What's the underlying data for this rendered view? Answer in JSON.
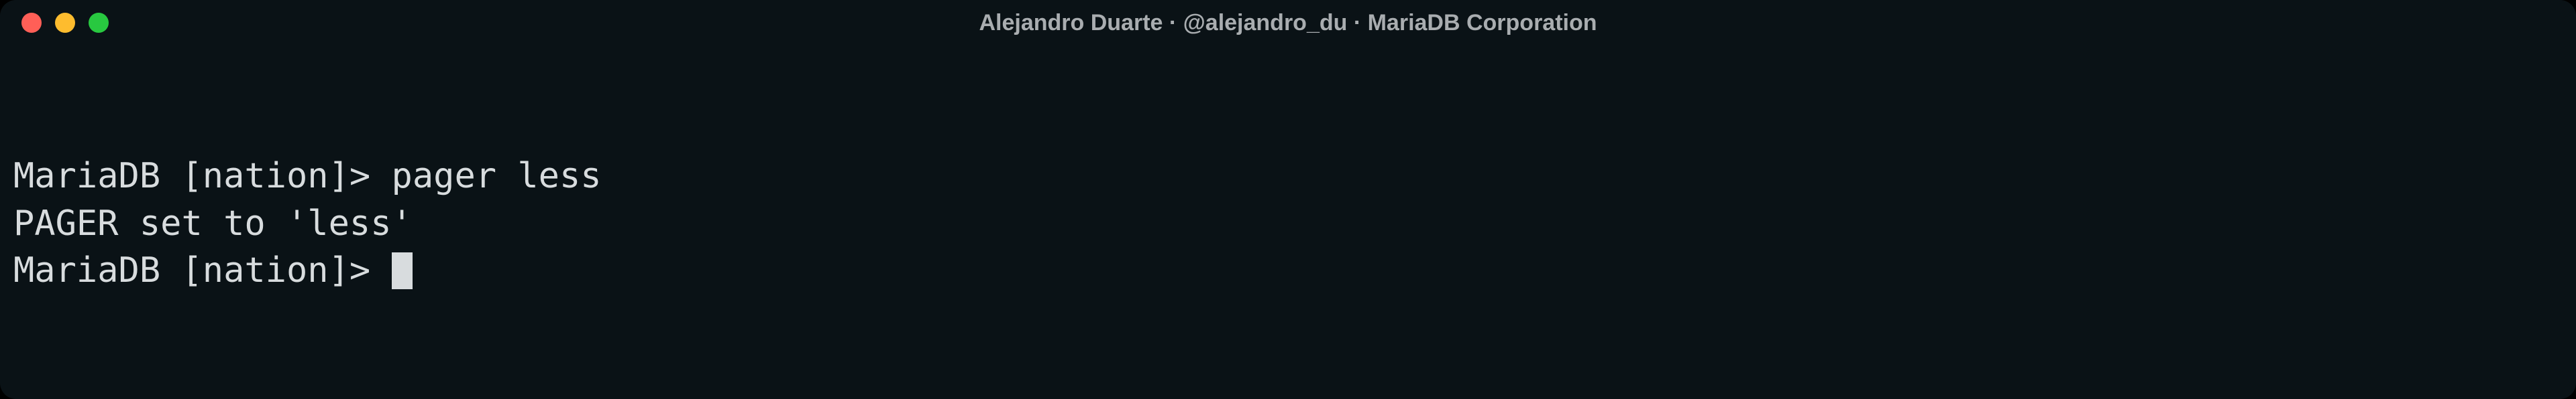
{
  "window": {
    "title": "Alejandro Duarte · @alejandro_du · MariaDB Corporation"
  },
  "terminal": {
    "lines": {
      "l0_prompt": "MariaDB [nation]> ",
      "l0_cmd": "pager less",
      "l1": "PAGER set to 'less'",
      "l2_prompt": "MariaDB [nation]> "
    }
  }
}
